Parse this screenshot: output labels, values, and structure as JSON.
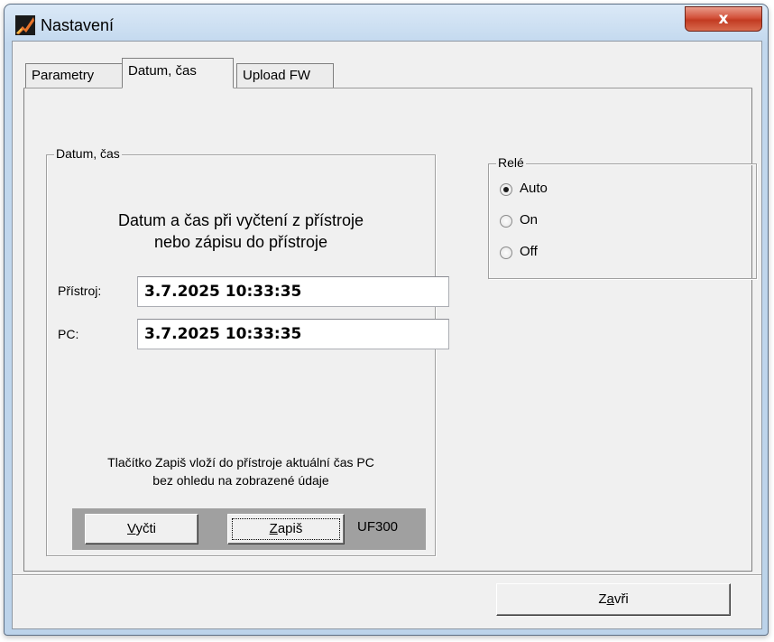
{
  "window": {
    "title": "Nastavení",
    "close_glyph": "x"
  },
  "tabs": [
    {
      "label": "Parametry"
    },
    {
      "label": "Datum, čas"
    },
    {
      "label": "Upload FW"
    }
  ],
  "datetime_group": {
    "title": "Datum, čas",
    "info_line1": "Datum a čas při vyčtení z přístroje",
    "info_line2": "nebo zápisu do přístroje",
    "device_label": "Přístroj:",
    "device_value": "3.7.2025 10:33:35",
    "pc_label": "PC:",
    "pc_value": "3.7.2025 10:33:35",
    "note_line1": "Tlačítko Zapiš vloží do přístroje aktuální čas PC",
    "note_line2": "bez ohledu na zobrazené údaje",
    "read_button": {
      "mnemonic": "V",
      "rest": "yčti"
    },
    "write_button": {
      "mnemonic": "Z",
      "rest": "apiš"
    },
    "device_model": "UF300"
  },
  "relay_group": {
    "title": "Relé",
    "options": [
      {
        "label": "Auto",
        "selected": true
      },
      {
        "label": "On",
        "selected": false
      },
      {
        "label": "Off",
        "selected": false
      }
    ]
  },
  "footer": {
    "close_button": {
      "pre": "Z",
      "mnemonic": "a",
      "rest": "vři"
    }
  },
  "colors": {
    "close_button": "#c23b22",
    "window_frame": "#c2d8ee",
    "button_strip": "#a0a0a0"
  }
}
